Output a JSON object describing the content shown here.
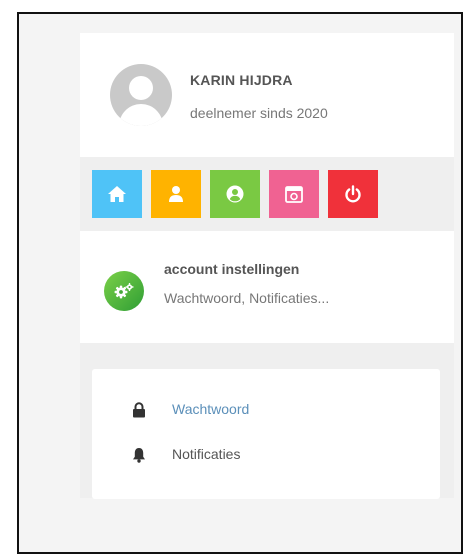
{
  "profile": {
    "name": "KARIN HIJDRA",
    "member_since": "deelnemer sinds 2020",
    "avatar_icon": "user-avatar-icon"
  },
  "icon_buttons": [
    {
      "icon": "home-icon",
      "color": "#4fc3f7"
    },
    {
      "icon": "person-icon",
      "color": "#ffb300"
    },
    {
      "icon": "account-circle-icon",
      "color": "#7ac943"
    },
    {
      "icon": "calendar-icon",
      "color": "#f06292"
    },
    {
      "icon": "power-icon",
      "color": "#f0313a"
    }
  ],
  "account": {
    "title": "account instellingen",
    "subtitle": "Wachtwoord, Notificaties...",
    "icon": "gears-icon"
  },
  "menu": {
    "items": [
      {
        "label": "Wachtwoord",
        "icon": "lock-icon",
        "active": true
      },
      {
        "label": "Notificaties",
        "icon": "bell-icon",
        "active": false
      }
    ]
  },
  "colors": {
    "active_link": "#5b8fb9",
    "text": "#555555"
  }
}
